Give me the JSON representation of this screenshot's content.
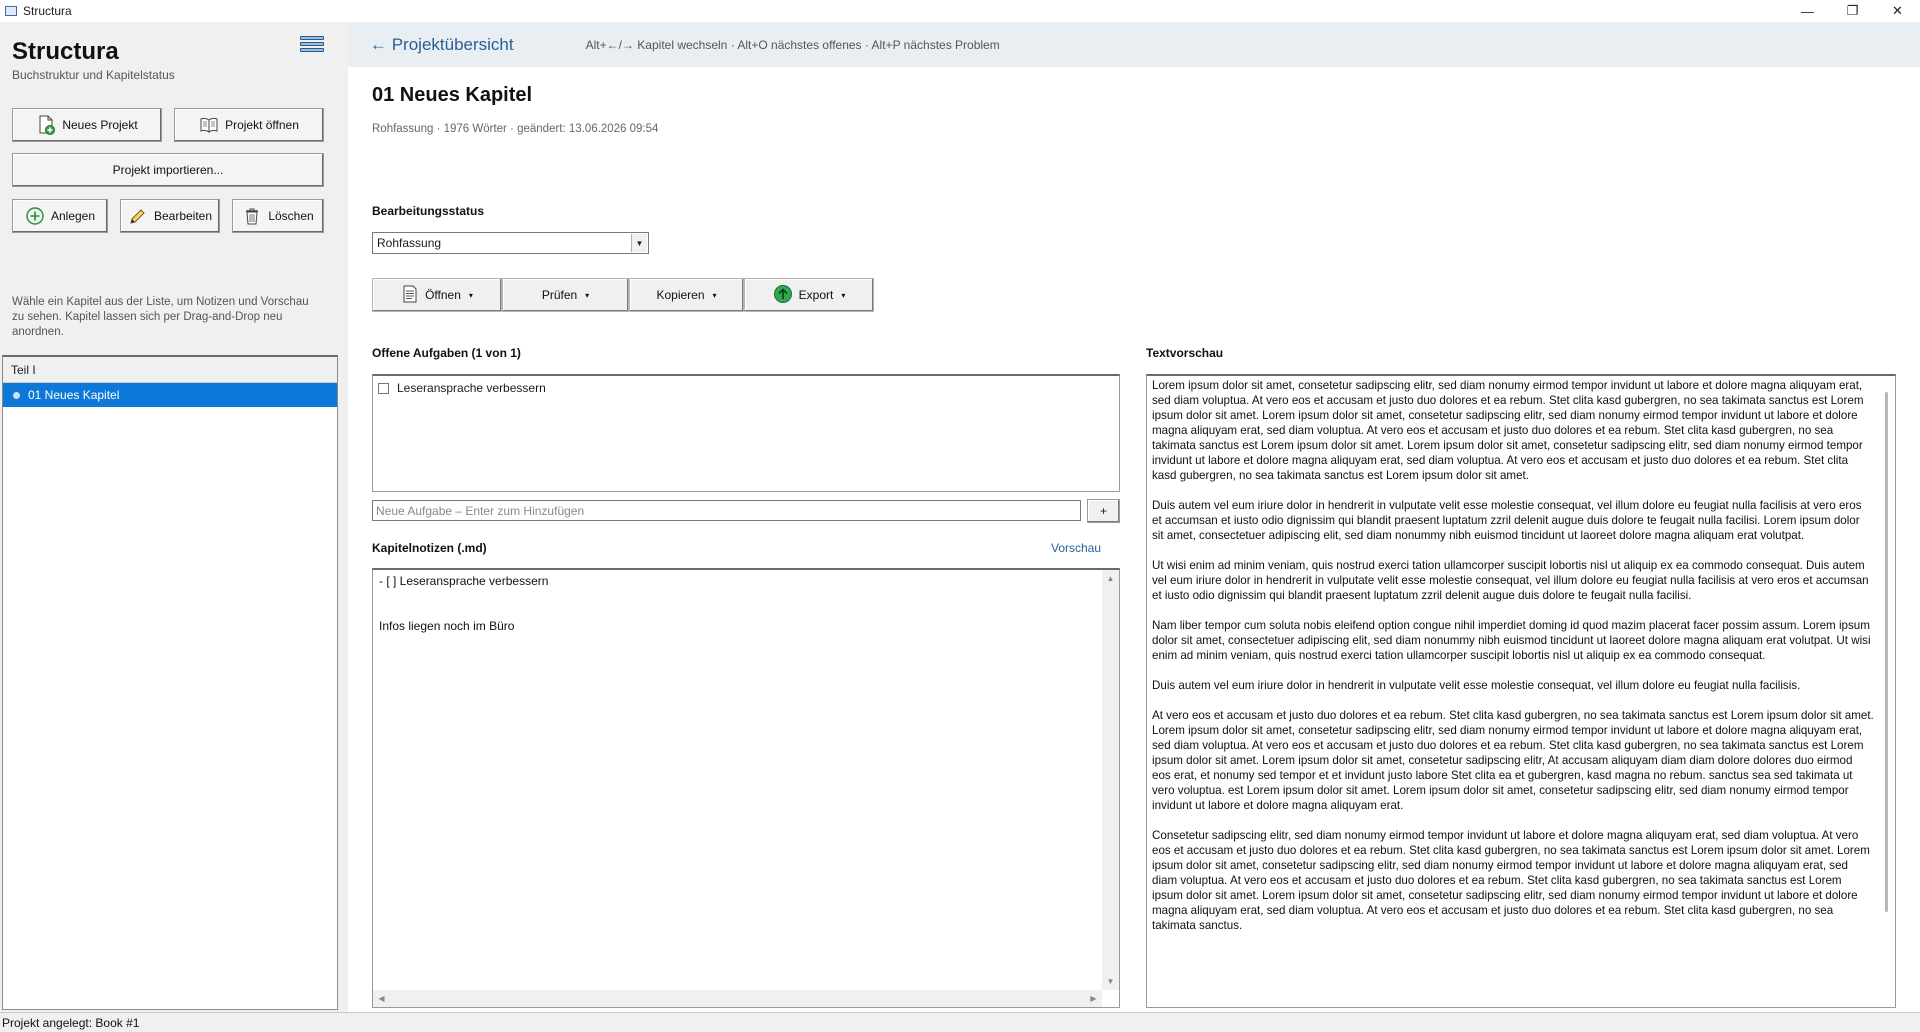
{
  "window": {
    "title": "Structura",
    "controls": {
      "minimize": "—",
      "maximize": "❐",
      "close": "✕"
    }
  },
  "sidebar": {
    "app_title": "Structura",
    "app_subtitle": "Buchstruktur und Kapitelstatus",
    "menu_icon": "hamburger-menu-icon",
    "buttons": {
      "new_project": "Neues Projekt",
      "open_project": "Projekt öffnen",
      "import_project": "Projekt importieren...",
      "create": "Anlegen",
      "edit": "Bearbeiten",
      "delete": "Löschen"
    },
    "hint": "Wähle ein Kapitel aus der Liste, um Notizen und Vorschau zu sehen. Kapitel lassen sich per Drag-and-Drop neu anordnen.",
    "tree": {
      "header": "Teil I",
      "items": [
        {
          "label": "01  Neues Kapitel",
          "selected": true
        }
      ]
    }
  },
  "topbar": {
    "back_link": "← Projektübersicht",
    "shortcuts": "Alt+←/→ Kapitel wechseln · Alt+O nächstes offenes · Alt+P nächstes Problem"
  },
  "chapter": {
    "title": "01  Neues Kapitel",
    "meta": "Rohfassung · 1976 Wörter · geändert: 13.06.2026 09:54"
  },
  "status": {
    "label": "Bearbeitungsstatus",
    "selected": "Rohfassung"
  },
  "actions": {
    "open": "Öffnen",
    "check": "Prüfen",
    "copy": "Kopieren",
    "export": "Export",
    "caret": "▾"
  },
  "tasks": {
    "label": "Offene Aufgaben (1 von 1)",
    "items": [
      {
        "label": "Leseransprache verbessern",
        "checked": false
      }
    ],
    "new_placeholder": "Neue Aufgabe – Enter zum Hinzufügen",
    "add_label": "+"
  },
  "notes": {
    "label": "Kapitelnotizen (.md)",
    "preview_link": "Vorschau",
    "content": "- [ ] Leseransprache verbessern\n\n\nInfos liegen noch im Büro"
  },
  "preview": {
    "label": "Textvorschau",
    "paragraphs": [
      "Lorem ipsum dolor sit amet, consetetur sadipscing elitr, sed diam nonumy eirmod tempor invidunt ut labore et dolore magna aliquyam erat, sed diam voluptua. At vero eos et accusam et justo duo dolores et ea rebum. Stet clita kasd gubergren, no sea takimata sanctus est Lorem ipsum dolor sit amet. Lorem ipsum dolor sit amet, consetetur sadipscing elitr, sed diam nonumy eirmod tempor invidunt ut labore et dolore magna aliquyam erat, sed diam voluptua. At vero eos et accusam et justo duo dolores et ea rebum. Stet clita kasd gubergren, no sea takimata sanctus est Lorem ipsum dolor sit amet. Lorem ipsum dolor sit amet, consetetur sadipscing elitr, sed diam nonumy eirmod tempor invidunt ut labore et dolore magna aliquyam erat, sed diam voluptua. At vero eos et accusam et justo duo dolores et ea rebum. Stet clita kasd gubergren, no sea takimata sanctus est Lorem ipsum dolor sit amet.",
      "Duis autem vel eum iriure dolor in hendrerit in vulputate velit esse molestie consequat, vel illum dolore eu feugiat nulla facilisis at vero eros et accumsan et iusto odio dignissim qui blandit praesent luptatum zzril delenit augue duis dolore te feugait nulla facilisi. Lorem ipsum dolor sit amet, consectetuer adipiscing elit, sed diam nonummy nibh euismod tincidunt ut laoreet dolore magna aliquam erat volutpat.",
      "Ut wisi enim ad minim veniam, quis nostrud exerci tation ullamcorper suscipit lobortis nisl ut aliquip ex ea commodo consequat. Duis autem vel eum iriure dolor in hendrerit in vulputate velit esse molestie consequat, vel illum dolore eu feugiat nulla facilisis at vero eros et accumsan et iusto odio dignissim qui blandit praesent luptatum zzril delenit augue duis dolore te feugait nulla facilisi.",
      "Nam liber tempor cum soluta nobis eleifend option congue nihil imperdiet doming id quod mazim placerat facer possim assum. Lorem ipsum dolor sit amet, consectetuer adipiscing elit, sed diam nonummy nibh euismod tincidunt ut laoreet dolore magna aliquam erat volutpat. Ut wisi enim ad minim veniam, quis nostrud exerci tation ullamcorper suscipit lobortis nisl ut aliquip ex ea commodo consequat.",
      "Duis autem vel eum iriure dolor in hendrerit in vulputate velit esse molestie consequat, vel illum dolore eu feugiat nulla facilisis.",
      "At vero eos et accusam et justo duo dolores et ea rebum. Stet clita kasd gubergren, no sea takimata sanctus est Lorem ipsum dolor sit amet. Lorem ipsum dolor sit amet, consetetur sadipscing elitr, sed diam nonumy eirmod tempor invidunt ut labore et dolore magna aliquyam erat, sed diam voluptua. At vero eos et accusam et justo duo dolores et ea rebum. Stet clita kasd gubergren, no sea takimata sanctus est Lorem ipsum dolor sit amet. Lorem ipsum dolor sit amet, consetetur sadipscing elitr, At accusam aliquyam diam diam dolore dolores duo eirmod eos erat, et nonumy sed tempor et et invidunt justo labore Stet clita ea et gubergren, kasd magna no rebum. sanctus sea sed takimata ut vero voluptua. est Lorem ipsum dolor sit amet. Lorem ipsum dolor sit amet, consetetur sadipscing elitr, sed diam nonumy eirmod tempor invidunt ut labore et dolore magna aliquyam erat.",
      "Consetetur sadipscing elitr, sed diam nonumy eirmod tempor invidunt ut labore et dolore magna aliquyam erat, sed diam voluptua. At vero eos et accusam et justo duo dolores et ea rebum. Stet clita kasd gubergren, no sea takimata sanctus est Lorem ipsum dolor sit amet. Lorem ipsum dolor sit amet, consetetur sadipscing elitr, sed diam nonumy eirmod tempor invidunt ut labore et dolore magna aliquyam erat, sed diam voluptua. At vero eos et accusam et justo duo dolores et ea rebum. Stet clita kasd gubergren, no sea takimata sanctus est Lorem ipsum dolor sit amet. Lorem ipsum dolor sit amet, consetetur sadipscing elitr, sed diam nonumy eirmod tempor invidunt ut labore et dolore magna aliquyam erat, sed diam voluptua. At vero eos et accusam et justo duo dolores et ea rebum. Stet clita kasd gubergren, no sea takimata sanctus."
    ]
  },
  "statusbar": {
    "text": "Projekt angelegt: Book #1"
  },
  "colors": {
    "accent": "#0d78d8",
    "link": "#2a5f95",
    "topbar_bg": "#e9eef3",
    "export_icon": "#2fa84f"
  }
}
